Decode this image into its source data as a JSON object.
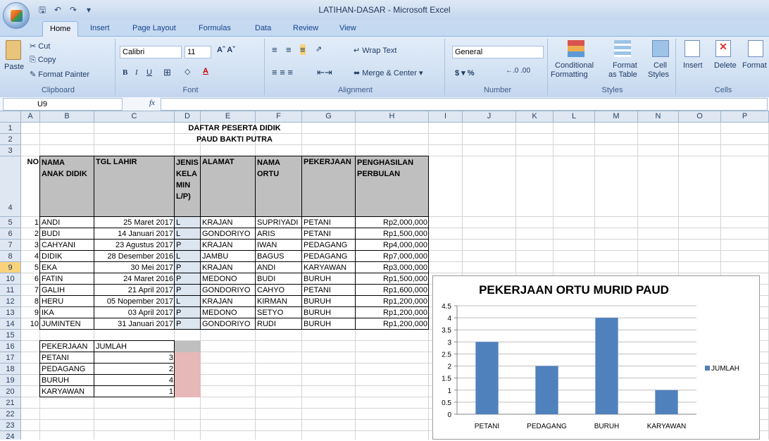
{
  "window": {
    "title": "LATIHAN-DASAR - Microsoft Excel"
  },
  "tabs": [
    "Home",
    "Insert",
    "Page Layout",
    "Formulas",
    "Data",
    "Review",
    "View"
  ],
  "ribbon": {
    "clipboard": {
      "paste": "Paste",
      "cut": "Cut",
      "copy": "Copy",
      "format_painter": "Format Painter",
      "label": "Clipboard"
    },
    "font": {
      "name": "Calibri",
      "size": "11",
      "label": "Font"
    },
    "alignment": {
      "wrap": "Wrap Text",
      "merge": "Merge & Center",
      "label": "Alignment"
    },
    "number": {
      "format": "General",
      "label": "Number"
    },
    "styles": {
      "conditional": "Conditional",
      "conditional2": "Formatting",
      "format_as": "Format",
      "format_as2": "as Table",
      "cell": "Cell",
      "cell2": "Styles",
      "label": "Styles"
    },
    "cells": {
      "insert": "Insert",
      "delete": "Delete",
      "format": "Format",
      "label": "Cells"
    }
  },
  "formula_bar": {
    "name_box": "U9",
    "fx": "fx",
    "value": ""
  },
  "columns": [
    "A",
    "B",
    "C",
    "D",
    "E",
    "F",
    "G",
    "H",
    "I",
    "J",
    "K",
    "L",
    "M",
    "N",
    "O",
    "P"
  ],
  "rows": [
    "1",
    "2",
    "3",
    "4",
    "5",
    "6",
    "7",
    "8",
    "9",
    "10",
    "11",
    "12",
    "13",
    "14",
    "15",
    "16",
    "17",
    "18",
    "19",
    "20",
    "21",
    "22",
    "23",
    "24"
  ],
  "selected_row": "9",
  "sheet": {
    "title1": "DAFTAR PESERTA DIDIK",
    "title2": "PAUD BAKTI PUTRA",
    "headers": {
      "no": "NO",
      "nama": [
        "NAMA",
        "ANAK DIDIK"
      ],
      "tgl": "TGL LAHIR",
      "jk": [
        "JENIS",
        "KELA",
        "MIN",
        "L/P)"
      ],
      "alamat": "ALAMAT",
      "ortu": [
        "NAMA",
        "ORTU"
      ],
      "pekerjaan": "PEKERJAAN",
      "penghasilan": [
        "PENGHASILAN",
        "PERBULAN"
      ]
    },
    "data": [
      [
        "1",
        "ANDI",
        "25 Maret 2017",
        "L",
        "KRAJAN",
        "SUPRIYADI",
        "PETANI",
        "Rp2,000,000"
      ],
      [
        "2",
        "BUDI",
        "14 Januari 2017",
        "L",
        "GONDORIYO",
        "ARIS",
        "PETANI",
        "Rp1,500,000"
      ],
      [
        "3",
        "CAHYANI",
        "23 Agustus 2017",
        "P",
        "KRAJAN",
        "IWAN",
        "PEDAGANG",
        "Rp4,000,000"
      ],
      [
        "4",
        "DIDIK",
        "28 Desember 2016",
        "L",
        "JAMBU",
        "BAGUS",
        "PEDAGANG",
        "Rp7,000,000"
      ],
      [
        "5",
        "EKA",
        "30 Mei 2017",
        "P",
        "KRAJAN",
        "ANDI",
        "KARYAWAN",
        "Rp3,000,000"
      ],
      [
        "6",
        "FATIN",
        "24 Maret 2016",
        "P",
        "MEDONO",
        "BUDI",
        "BURUH",
        "Rp1,500,000"
      ],
      [
        "7",
        "GALIH",
        "21 April 2017",
        "P",
        "GONDORIYO",
        "CAHYO",
        "PETANI",
        "Rp1,600,000"
      ],
      [
        "8",
        "HERU",
        "05 Nopember 2017",
        "L",
        "KRAJAN",
        "KIRMAN",
        "BURUH",
        "Rp1,200,000"
      ],
      [
        "9",
        "IKA",
        "03 April 2017",
        "P",
        "MEDONO",
        "SETYO",
        "BURUH",
        "Rp1,200,000"
      ],
      [
        "10",
        "JUMINTEN",
        "31 Januari 2017",
        "P",
        "GONDORIYO",
        "RUDI",
        "BURUH",
        "Rp1,200,000"
      ]
    ],
    "summary_headers": [
      "PEKERJAAN",
      "JUMLAH"
    ],
    "summary": [
      [
        "PETANI",
        "3"
      ],
      [
        "PEDAGANG",
        "2"
      ],
      [
        "BURUH",
        "4"
      ],
      [
        "KARYAWAN",
        "1"
      ]
    ]
  },
  "chart_data": {
    "type": "bar",
    "title": "PEKERJAAN ORTU MURID PAUD",
    "categories": [
      "PETANI",
      "PEDAGANG",
      "BURUH",
      "KARYAWAN"
    ],
    "series": [
      {
        "name": "JUMLAH",
        "values": [
          3,
          2,
          4,
          1
        ]
      }
    ],
    "ylim": [
      0,
      4.5
    ],
    "yticks": [
      "0",
      "0.5",
      "1",
      "1.5",
      "2",
      "2.5",
      "3",
      "3.5",
      "4",
      "4.5"
    ],
    "legend": "right",
    "grid": true,
    "bar_color": "#4f81bd"
  }
}
